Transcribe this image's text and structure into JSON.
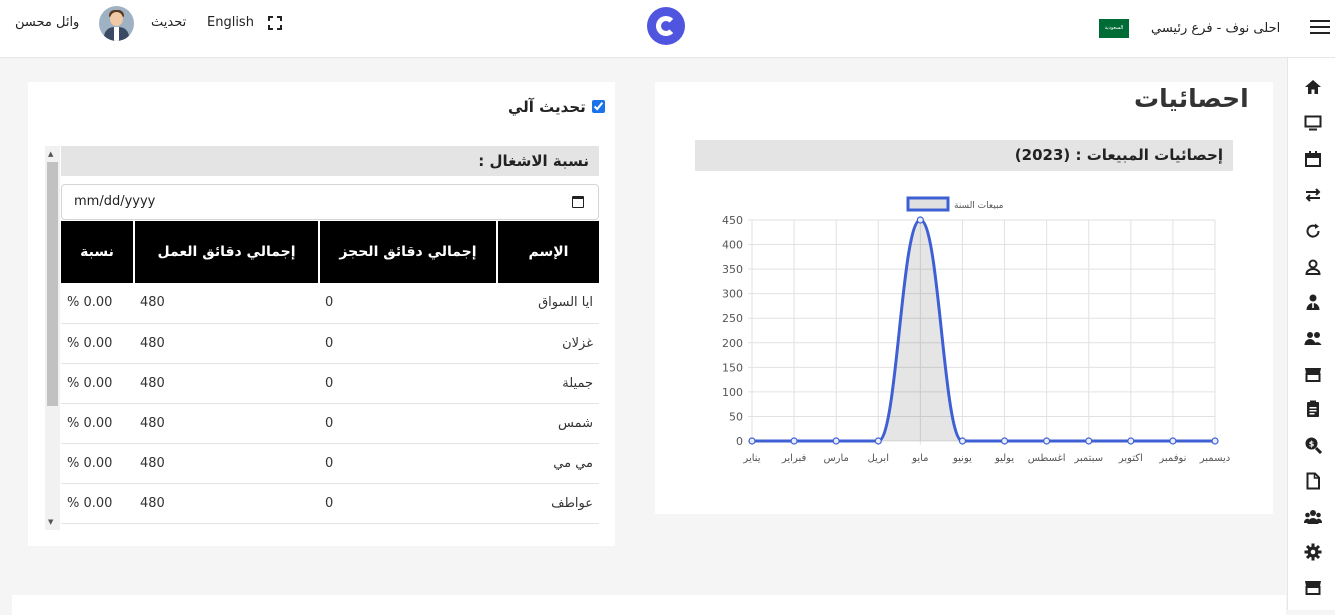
{
  "header": {
    "user_name": "وائل محسن",
    "refresh_label": "تحديث",
    "language_label": "English",
    "branch_name": "احلى نوف - فرع رئيسي",
    "flag_text": "السعودية"
  },
  "sidebar": {
    "icons": [
      "home-icon",
      "monitor-icon",
      "calendar-icon",
      "transfer-icon",
      "refresh-icon",
      "user-icon",
      "employee-icon",
      "users-icon",
      "store-icon",
      "document-icon",
      "search-money-icon",
      "file-icon",
      "group-icon",
      "settings-icon",
      "shop-icon"
    ]
  },
  "stats": {
    "title": "احصائيات",
    "sales_heading": "إحصائيات المبيعات : (2023)"
  },
  "chart_data": {
    "type": "line",
    "legend": "مبيعات السنة",
    "categories": [
      "يناير",
      "فبراير",
      "مارس",
      "ابريل",
      "مايو",
      "يونيو",
      "يوليو",
      "اغسطس",
      "سبتمبر",
      "اكتوبر",
      "نوفمبر",
      "ديسمبر"
    ],
    "y_ticks": [
      "0",
      "50",
      "100",
      "150",
      "200",
      "250",
      "300",
      "350",
      "400",
      "450"
    ],
    "series": [
      {
        "name": "مبيعات السنة",
        "values": [
          0,
          0,
          0,
          0,
          450,
          0,
          0,
          0,
          0,
          0,
          0,
          0
        ]
      }
    ],
    "ylim": [
      0,
      450
    ],
    "grid": true,
    "legend_position": "top",
    "line_color": "#3f5fd4"
  },
  "occupancy": {
    "auto_refresh_label": "تحديث آلي",
    "heading": "نسبة الاشغال :",
    "date_placeholder": "mm/dd/yyyy",
    "columns": [
      "الإسم",
      "إجمالي دقائق الحجز",
      "إجمالي دقائق العمل",
      "نسبة"
    ],
    "rows": [
      {
        "name": "ايا السواق",
        "booked": "0",
        "work": "480",
        "ratio": "0.00 %"
      },
      {
        "name": "غزلان",
        "booked": "0",
        "work": "480",
        "ratio": "0.00 %"
      },
      {
        "name": "جميلة",
        "booked": "0",
        "work": "480",
        "ratio": "0.00 %"
      },
      {
        "name": "شمس",
        "booked": "0",
        "work": "480",
        "ratio": "0.00 %"
      },
      {
        "name": "مي مي",
        "booked": "0",
        "work": "480",
        "ratio": "0.00 %"
      },
      {
        "name": "عواطف",
        "booked": "0",
        "work": "480",
        "ratio": "0.00 %"
      }
    ]
  }
}
